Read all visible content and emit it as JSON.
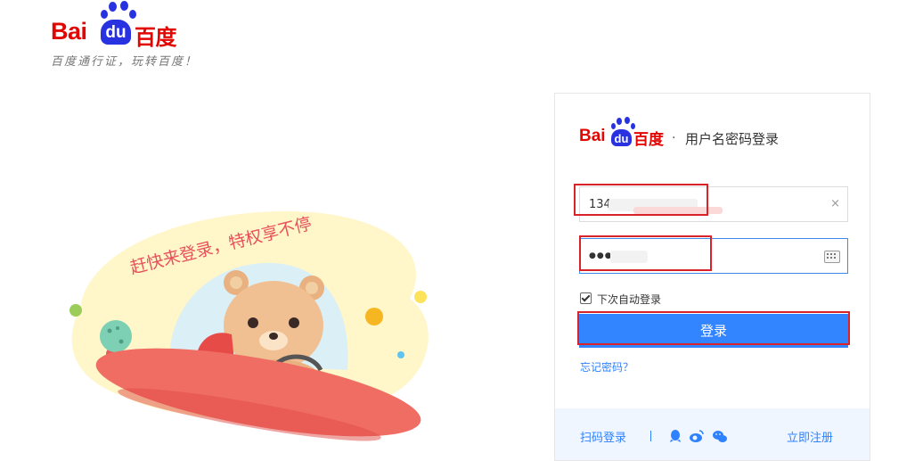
{
  "header": {
    "logo_bai": "Bai",
    "logo_du": "du",
    "logo_cn": "百度",
    "slogan": "百度通行证，玩转百度！"
  },
  "illustration": {
    "banner_text": "赶快来登录，特权享不停"
  },
  "panel": {
    "logo_bai": "Bai",
    "logo_du": "du",
    "logo_cn": "百度",
    "separator": "·",
    "title": "用户名密码登录",
    "username": {
      "value": "134",
      "clear_icon": "×"
    },
    "password": {
      "value": "●●●●"
    },
    "remember_label": "下次自动登录",
    "remember_checked": true,
    "login_label": "登录",
    "forgot_label": "忘记密码？",
    "footer": {
      "qr_label": "扫码登录",
      "register_label": "立即注册",
      "social_icons": [
        "qq-icon",
        "weibo-icon",
        "wechat-icon"
      ]
    }
  },
  "colors": {
    "brand_red": "#e10601",
    "brand_blue": "#2932e1",
    "button_blue": "#3385ff",
    "link_blue": "#2e82ff",
    "highlight_red": "#d9232b",
    "footer_bg": "#f0f6ff"
  }
}
